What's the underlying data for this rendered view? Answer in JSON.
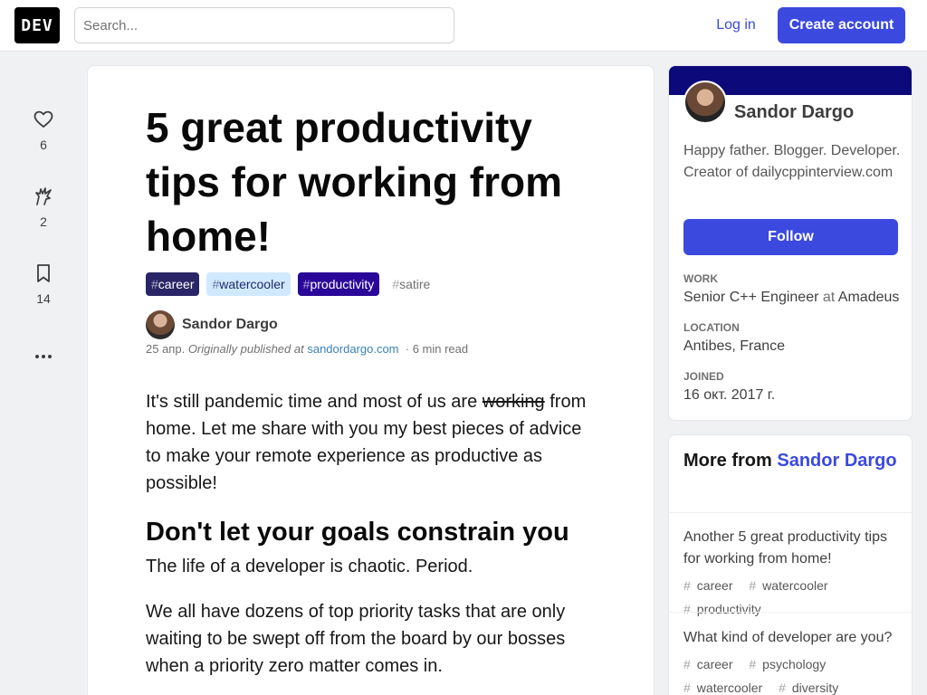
{
  "header": {
    "logo": "DEV",
    "search_placeholder": "Search...",
    "login_label": "Log in",
    "create_account_label": "Create account"
  },
  "reactions": {
    "likes": "6",
    "unicorns": "2",
    "bookmarks": "14"
  },
  "article": {
    "title": "5 great productivity tips for working from home!",
    "tags": [
      {
        "hash": "#",
        "name": "career"
      },
      {
        "hash": "#",
        "name": "watercooler"
      },
      {
        "hash": "#",
        "name": "productivity"
      },
      {
        "hash": "#",
        "name": "satire"
      }
    ],
    "author": "Sandor Dargo",
    "date": "25 апр.",
    "originally_published": "Originally published at",
    "source": "sandordargo.com",
    "read_time": "6 min read",
    "intro_pre": "It's still pandemic time and most of us are",
    "intro_strike": "working",
    "intro_post": "from home. Let me share with you my best pieces of advice to make your remote experience as productive as possible!",
    "heading1": "Don't let your goals constrain you",
    "para1": "The life of a developer is chaotic. Period.",
    "para2": "We all have dozens of top priority tasks that are only waiting to be swept off from the board by our bosses when a priority zero matter comes in."
  },
  "profile": {
    "name": "Sandor Dargo",
    "bio": "Happy father. Blogger. Developer. Creator of dailycppinterview.com",
    "follow_label": "Follow",
    "work_label": "WORK",
    "work_title": "Senior C++ Engineer",
    "work_at": "at",
    "work_company": "Amadeus",
    "location_label": "LOCATION",
    "location": "Antibes, France",
    "joined_label": "JOINED",
    "joined": "16 окт. 2017 г."
  },
  "more_from": {
    "prefix": "More from",
    "author": "Sandor Dargo",
    "posts": [
      {
        "title": "Another 5 great productivity tips for working from home!",
        "tags": [
          "career",
          "watercooler",
          "productivity"
        ]
      },
      {
        "title": "What kind of developer are you?",
        "tags": [
          "career",
          "psychology",
          "watercooler",
          "diversity"
        ]
      }
    ]
  },
  "colors": {
    "accent": "#3b49df",
    "profile_band": "#0c0a7a"
  }
}
